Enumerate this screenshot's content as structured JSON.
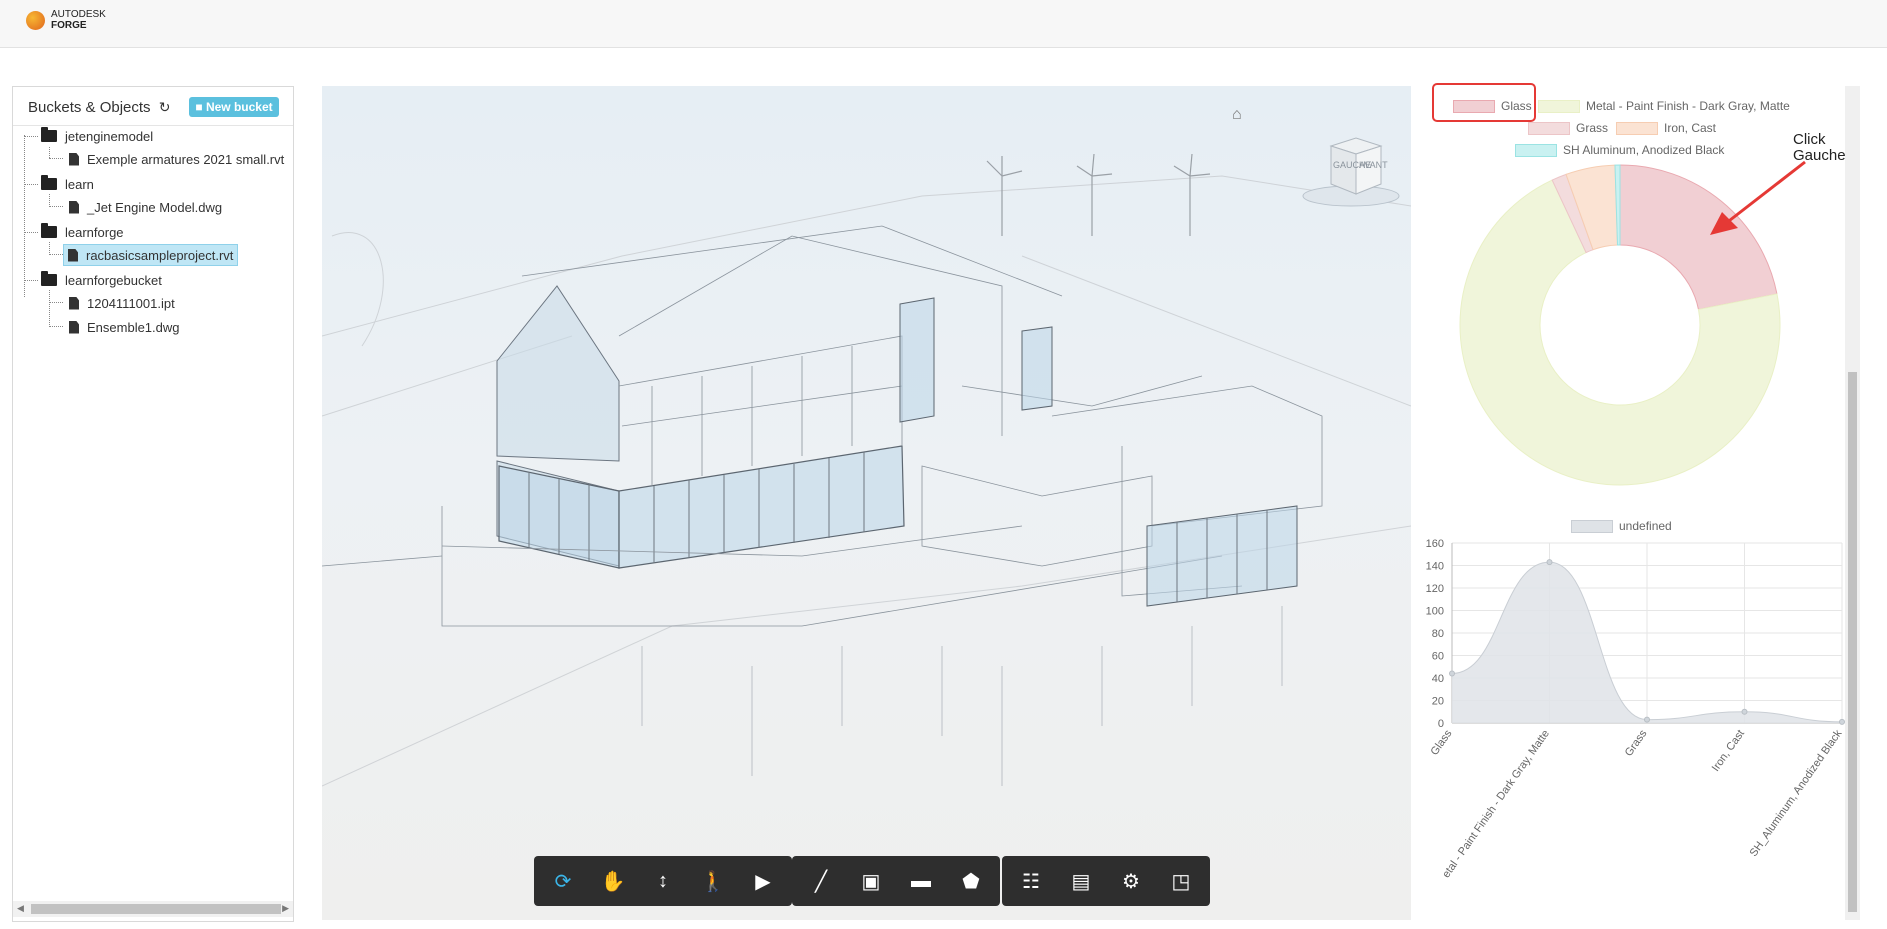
{
  "header": {
    "brand_top": "AUTODESK",
    "brand_bottom": "FORGE"
  },
  "tree": {
    "title": "Buckets & Objects",
    "new_bucket_label": "New bucket",
    "items": [
      {
        "label": "jetenginemodel",
        "type": "folder"
      },
      {
        "label": "Exemple armatures 2021 small.rvt",
        "type": "file"
      },
      {
        "label": "learn",
        "type": "folder"
      },
      {
        "label": "_Jet Engine Model.dwg",
        "type": "file"
      },
      {
        "label": "learnforge",
        "type": "folder"
      },
      {
        "label": "racbasicsampleproject.rvt",
        "type": "file",
        "selected": true
      },
      {
        "label": "learnforgebucket",
        "type": "folder"
      },
      {
        "label": "1204111001.ipt",
        "type": "file"
      },
      {
        "label": "Ensemble1.dwg",
        "type": "file"
      }
    ]
  },
  "viewer": {
    "viewcube_left": "GAUCHE",
    "viewcube_front": "AVANT",
    "toolbar_groups": [
      [
        "orbit-icon",
        "pan-icon",
        "zoom-icon",
        "first-person-icon",
        "camera-icon"
      ],
      [
        "measure-icon",
        "section-icon",
        "model-browser-icon",
        "explode-icon"
      ],
      [
        "structure-icon",
        "properties-icon",
        "settings-icon",
        "fullscreen-icon"
      ]
    ]
  },
  "callout": {
    "line1": "Click",
    "line2": "Gauche"
  },
  "chart_data": [
    {
      "type": "pie",
      "donut": true,
      "legend_position": "top",
      "categories": [
        "Glass",
        "Metal - Paint Finish - Dark Gray, Matte",
        "Grass",
        "Iron, Cast",
        "SH  Aluminum, Anodized Black"
      ],
      "values": [
        44,
        143,
        3,
        10,
        1
      ],
      "colors": [
        "#f1cfd3",
        "#f0f5da",
        "#f3dcdd",
        "#fbe3d3",
        "#c9f1f1"
      ],
      "borders": [
        "#e9a9b0",
        "#e9f0c6",
        "#ecc5c7",
        "#f6cdb2",
        "#9be3e3"
      ]
    },
    {
      "type": "area",
      "legend": [
        "undefined"
      ],
      "legend_position": "top",
      "categories": [
        "Glass",
        "Metal - Paint Finish - Dark Gray, Matte",
        "Grass",
        "Iron, Cast",
        "SH_Aluminum, Anodized Black"
      ],
      "tick_labels": [
        "Glass",
        "etal - Paint Finish - Dark Gray, Matte",
        "Grass",
        "Iron, Cast",
        "SH_Aluminum, Anodized Black"
      ],
      "values": [
        44,
        143,
        3,
        10,
        1
      ],
      "y_ticks": [
        "0",
        "20",
        "40",
        "60",
        "80",
        "100",
        "120",
        "140",
        "160"
      ],
      "ylim": [
        0,
        160
      ],
      "grid": true,
      "fill_color": "#dfe3e7",
      "line_color": "#c9ced4"
    }
  ]
}
